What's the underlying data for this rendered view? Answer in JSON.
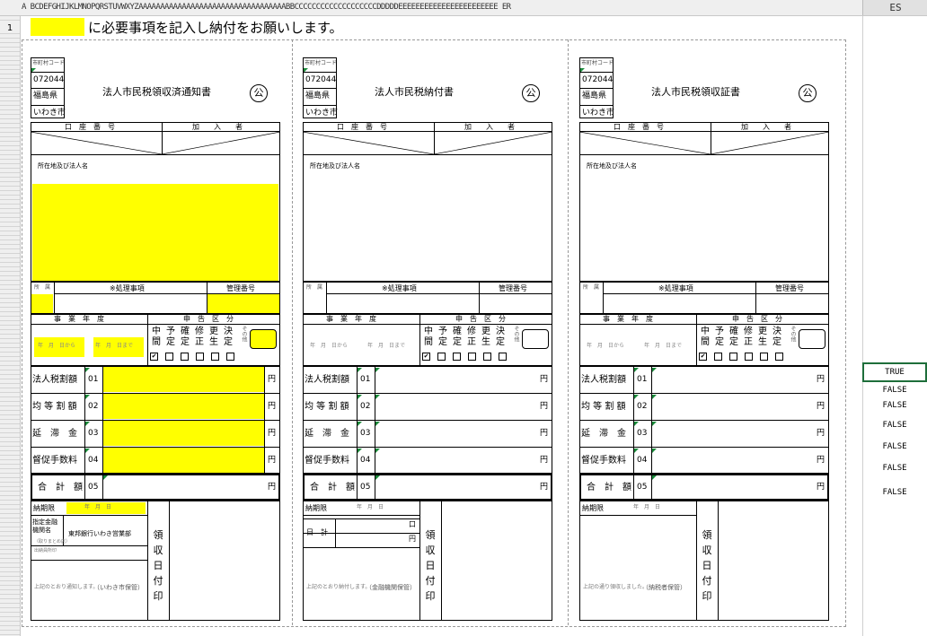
{
  "sheet": {
    "column_header_text": "A BCDEFGHIJKLMNOPQRSTUVWXYZAAAAAAAAAAAAAAAAAAAAAAAAAAAAAAAAAABBCCCCCCCCCCCCCCCCCCCDDDDDEEEEEEEEEEEEEEEEEEEEEEE ER",
    "column_header_es": "ES",
    "row_header_first": "1"
  },
  "instruction": "に必要事項を記入し納付をお願いします。",
  "forms": [
    {
      "title": "法人市民税領収済通知書",
      "code_label": "市町村コード",
      "code": "072044",
      "pref": "福島県",
      "city": "いわき市",
      "acct_label": "口　座　番　号",
      "subscriber_label": "加　　入　　者",
      "addr_label": "所在地及び法人名",
      "shozoku_label": "所　属",
      "proc_label": "※処理事項",
      "mgmt_label": "管理番号",
      "year_label": "事　業　年　度",
      "kubun_label": "申　告　区　分",
      "kubun": [
        "中間",
        "予定",
        "確定",
        "修正",
        "更生",
        "決定"
      ],
      "sonota": "その他",
      "date_from": "年　月　日から",
      "date_to": "年　月　日まで",
      "rows": [
        {
          "label": "法人税割額",
          "num": "01"
        },
        {
          "label": "均 等 割 額",
          "num": "02"
        },
        {
          "label": "延　滞　金",
          "num": "03"
        },
        {
          "label": "督促手数料",
          "num": "04"
        }
      ],
      "total_label": "合　計　額",
      "total_num": "05",
      "yen": "円",
      "deadline_label": "納期限",
      "deadline_value": "年　月　日",
      "bank_label": "指定金融機関名",
      "bank_value": "東邦銀行いわき営業部",
      "bank_sub": "（取りまとめ店）",
      "extra_label": "出納員所印",
      "footer": "上記のとおり通知します。",
      "footer_keep": "（いわき市保管）",
      "ryoushu": "領収日付印"
    },
    {
      "title": "法人市民税納付書",
      "code_label": "市町村コード",
      "code": "072044",
      "pref": "福島県",
      "city": "いわき市",
      "acct_label": "口　座　番　号",
      "subscriber_label": "加　　入　　者",
      "addr_label": "所在地及び法人名",
      "shozoku_label": "所　属",
      "proc_label": "※処理事項",
      "mgmt_label": "管理番号",
      "year_label": "事　業　年　度",
      "kubun_label": "申　告　区　分",
      "kubun": [
        "中間",
        "予定",
        "確定",
        "修正",
        "更生",
        "決定"
      ],
      "sonota": "その他",
      "date_from": "年　月　日から",
      "date_to": "年　月　日まで",
      "rows": [
        {
          "label": "法人税割額",
          "num": "01"
        },
        {
          "label": "均 等 割 額",
          "num": "02"
        },
        {
          "label": "延　滞　金",
          "num": "03"
        },
        {
          "label": "督促手数料",
          "num": "04"
        }
      ],
      "total_label": "合　計　額",
      "total_num": "05",
      "yen": "円",
      "deadline_label": "納期限",
      "deadline_value": "年　月　日",
      "nichikei_label": "日　計",
      "nichikei_circle": "口",
      "footer": "上記のとおり納付します。",
      "footer_keep": "（金融機関保管）",
      "ryoushu": "領収日付印"
    },
    {
      "title": "法人市民税領収証書",
      "code_label": "市町村コード",
      "code": "072044",
      "pref": "福島県",
      "city": "いわき市",
      "acct_label": "口　座　番　号",
      "subscriber_label": "加　　入　　者",
      "addr_label": "所在地及び法人名",
      "shozoku_label": "所　属",
      "proc_label": "※処理事項",
      "mgmt_label": "管理番号",
      "year_label": "事　業　年　度",
      "kubun_label": "申　告　区　分",
      "kubun": [
        "中間",
        "予定",
        "確定",
        "修正",
        "更生",
        "決定"
      ],
      "sonota": "その他",
      "date_from": "年　月　日から",
      "date_to": "年　月　日まで",
      "rows": [
        {
          "label": "法人税割額",
          "num": "01"
        },
        {
          "label": "均 等 割 額",
          "num": "02"
        },
        {
          "label": "延　滞　金",
          "num": "03"
        },
        {
          "label": "督促手数料",
          "num": "04"
        }
      ],
      "total_label": "合　計　額",
      "total_num": "05",
      "yen": "円",
      "deadline_label": "納期限",
      "deadline_value": "年　月　日",
      "footer": "上記の通り領収しました。",
      "footer_keep": "（納税者保管）",
      "ryoushu": "領収日付印"
    }
  ],
  "stamp_char": "公",
  "bools": [
    "TRUE",
    "FALSE",
    "FALSE",
    "FALSE",
    "FALSE",
    "FALSE",
    "FALSE"
  ],
  "colors": {
    "highlight": "#ffff00",
    "select_border": "#1e6e3a",
    "corner_mark": "#1a8a3a"
  }
}
